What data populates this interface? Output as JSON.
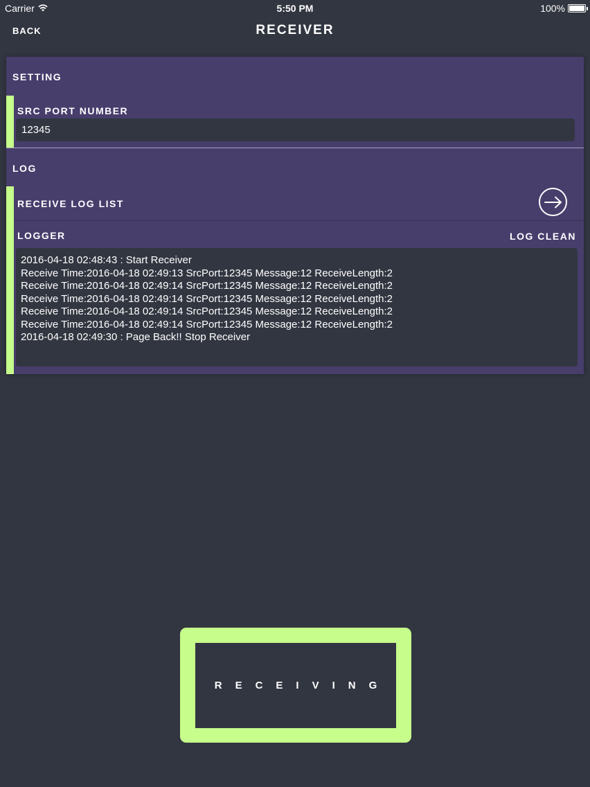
{
  "status_bar": {
    "carrier": "Carrier",
    "time": "5:50 PM",
    "battery": "100%",
    "battery_level": 1.0
  },
  "nav": {
    "back_label": "BACK",
    "title": "RECEIVER"
  },
  "setting": {
    "header": "SETTING",
    "src_port_label": "SRC PORT NUMBER",
    "src_port_value": "12345"
  },
  "log": {
    "header": "LOG",
    "receive_log_list_label": "RECEIVE LOG LIST",
    "logger_label": "LOGGER",
    "log_clean_label": "LOG CLEAN",
    "lines": [
      "2016-04-18 02:48:43 : Start Receiver",
      "Receive Time:2016-04-18 02:49:13 SrcPort:12345 Message:12 ReceiveLength:2",
      "Receive Time:2016-04-18 02:49:14 SrcPort:12345 Message:12 ReceiveLength:2",
      "Receive Time:2016-04-18 02:49:14 SrcPort:12345 Message:12 ReceiveLength:2",
      "Receive Time:2016-04-18 02:49:14 SrcPort:12345 Message:12 ReceiveLength:2",
      "Receive Time:2016-04-18 02:49:14 SrcPort:12345 Message:12 ReceiveLength:2",
      "2016-04-18 02:49:30 : Page Back!! Stop Receiver"
    ]
  },
  "receiving_button": {
    "label": "RECEIVING"
  },
  "colors": {
    "background": "#323641",
    "panel": "#473e6c",
    "accent": "#c6fd8b"
  },
  "icons": {
    "arrow": "arrow-right-circle-icon",
    "wifi": "wifi-icon",
    "battery": "battery-icon"
  }
}
